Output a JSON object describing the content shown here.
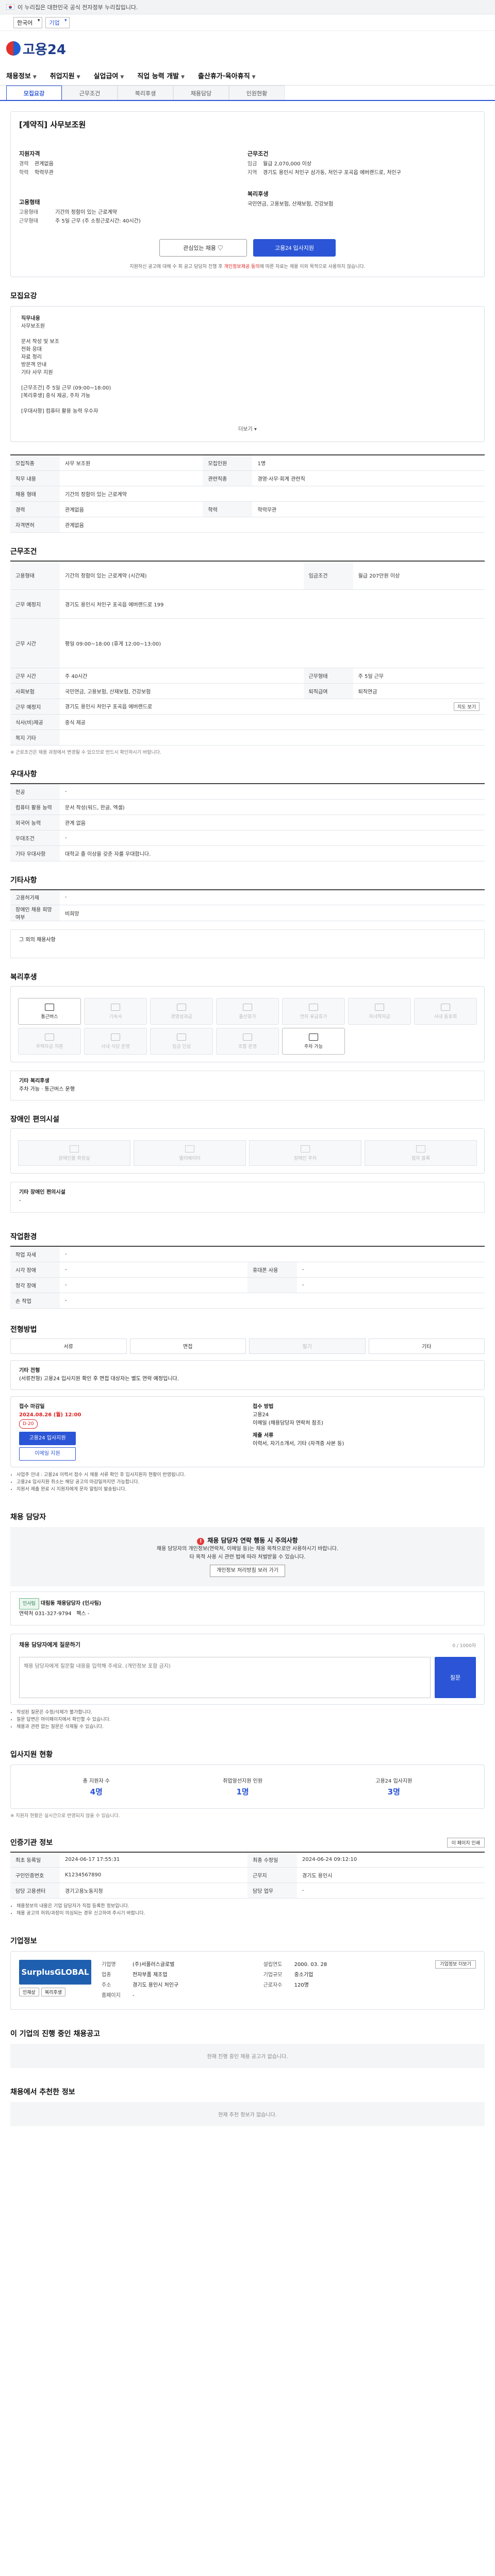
{
  "topbar": {
    "notice": "이 누리집은 대한민국 공식 전자정부 누리집입니다."
  },
  "topbar2": {
    "lang_label": "한국어",
    "lang_select": "기업"
  },
  "brand": {
    "name": "고용24"
  },
  "gnb": [
    "채용정보",
    "취업지원",
    "실업급여",
    "직업 능력 개발",
    "출산휴가·육아휴직"
  ],
  "tabs": [
    "모집요강",
    "근무조건",
    "복리후생",
    "채용담당",
    "인원현황"
  ],
  "job": {
    "title": "[계약직] 사무보조원",
    "left_label": "지원자격",
    "left": [
      [
        "경력",
        "관계없음"
      ],
      [
        "학력",
        "학력무관"
      ]
    ],
    "right_label": "근무조건",
    "right": [
      [
        "임금",
        "월급 2,070,000 이상"
      ],
      [
        "지역",
        "경기도 용인시 처인구 삼가동, 처인구 포곡읍 에버랜드로, 처인구"
      ]
    ],
    "emp_label": "고용형태",
    "emp": [
      [
        "고용형태",
        "기간의 정함이 있는 근로계약"
      ],
      [
        "근무형태",
        "주 5일 근무 (주 소정근로시간: 40시간)"
      ]
    ],
    "benefit_label": "복리후생",
    "benefit": "국민연금, 고용보험, 산재보험, 건강보험"
  },
  "actions": {
    "save": "관심있는 채용 ♡",
    "apply": "고용24 입사지원",
    "note_prefix": "지원하신 공고에 대해 수 회 공고 담당자 진행 후",
    "note_red": "개인정보제공 동의",
    "note_suffix": "에 따른 자료는 채용 이외 목적으로 사용하지 않습니다."
  },
  "recruit": {
    "title": "모집요강",
    "desc_head": "직무내용",
    "desc": [
      "사무보조원",
      "",
      "문서 작성 및 보조",
      "전화 응대",
      "자료 정리",
      "방문객 안내",
      "기타 사무 지원",
      "",
      "[근무조건] 주 5일 근무 (09:00~18:00)",
      "[복리후생] 중식 제공, 주차 가능",
      "",
      "[우대사항] 컴퓨터 활용 능력 우수자"
    ],
    "more": "더보기",
    "rows": [
      [
        "모집직종",
        "사무 보조원",
        "모집인원",
        "1명"
      ],
      [
        "직무 내용",
        "",
        "관련직종",
        "경영·사무·회계 관련직"
      ],
      [
        "채용 형태",
        "기간의 정함이 있는 근로계약",
        "",
        ""
      ],
      [
        "경력",
        "관계없음",
        "학력",
        "학력무관"
      ],
      [
        "자격면허",
        "관계없음",
        "",
        ""
      ]
    ]
  },
  "conditions": {
    "title": "근무조건",
    "rows": [
      [
        "고용형태",
        "기간의 정함이 있는 근로계약 (시간제)",
        "임금조건",
        "월급 207만원 이상"
      ],
      [
        "근무 예정지",
        "경기도 용인시 처인구 포곡읍 에버랜드로 199",
        "",
        ""
      ],
      [
        "근무 시간",
        "평일 09:00~18:00 (휴게 12:00~13:00)",
        "",
        ""
      ],
      [
        "근무 시간",
        "주 40시간",
        "근무형태",
        "주 5일 근무"
      ],
      [
        "사회보험",
        "국민연금, 고용보험, 산재보험, 건강보험",
        "퇴직급여",
        "퇴직연금"
      ],
      [
        "근무 예정지",
        "경기도 용인시 처인구 포곡읍 에버랜드로",
        "",
        ""
      ],
      [
        "식사(비)제공",
        "중식 제공",
        "",
        ""
      ],
      [
        "복지 기타",
        "",
        "",
        ""
      ]
    ],
    "map_btn": "지도 보기",
    "foot": "※ 근로조건은 채용 과정에서 변경될 수 있으므로 반드시 확인하시기 바랍니다."
  },
  "prefer": {
    "title": "우대사항",
    "rows": [
      [
        "전공",
        "-",
        "",
        ""
      ],
      [
        "컴퓨터 활용 능력",
        "문서 작성(워드, 한글, 엑셀)",
        "",
        ""
      ],
      [
        "외국어 능력",
        "관계 없음",
        "",
        ""
      ],
      [
        "우대조건",
        "-",
        "",
        ""
      ],
      [
        "기타 우대사항",
        "대학교 졸 이상을 갖춘 자를 우대합니다.",
        "",
        ""
      ]
    ]
  },
  "preferences": {
    "title": "기타사항",
    "rows": [
      [
        "고용허가제",
        "-"
      ],
      [
        "장애인 채용 희망 여부",
        "비희망"
      ]
    ],
    "etc": "그 외의 채용사항"
  },
  "benefits": {
    "title": "복리후생",
    "items": [
      [
        "통근버스",
        true
      ],
      [
        "기숙사",
        false
      ],
      [
        "경영성과급",
        false
      ],
      [
        "출산휴가",
        false
      ],
      [
        "연차 유급휴가",
        false
      ],
      [
        "자녀학자금",
        false
      ],
      [
        "사내 동호회",
        false
      ],
      [
        "주택자금 지원",
        false
      ],
      [
        "사내 식당 운영",
        false
      ],
      [
        "임금 인상",
        false
      ],
      [
        "조합 운영",
        false
      ],
      [
        "주차 가능",
        true
      ]
    ],
    "sub_head": "기타 복리후생",
    "sub": "주차 가능 · 통근버스 운행"
  },
  "disabled": {
    "title": "장애인 편의시설",
    "items": [
      "장애인용 화장실",
      "엘리베이터",
      "장애인 주차",
      "점자 블록"
    ],
    "sub_head": "기타 장애인 편의시설",
    "sub": "-"
  },
  "workplace": {
    "title": "작업환경",
    "rows": [
      [
        "작업 자세",
        "-",
        "",
        ""
      ],
      [
        "시각 장애",
        "-",
        "휴대폰 사용",
        "-"
      ],
      [
        "청각 장애",
        "-",
        "",
        "-"
      ],
      [
        "손 작업",
        "-",
        "",
        ""
      ]
    ]
  },
  "apply": {
    "title": "전형방법",
    "tabs": [
      [
        "서류",
        false
      ],
      [
        "면접",
        false
      ],
      [
        "필기",
        true
      ],
      [
        "기타",
        false
      ]
    ],
    "etc_head": "기타 전형",
    "etc": "(서류전형) 고용24 입사지원 확인 후 면접 대상자는 별도 연락 예정입니다.",
    "period_head": "접수 마감일",
    "period": "2024.08.26 (월) 12:00",
    "dday": "D-20",
    "apply_btn": "고용24 입사지원",
    "mail_btn": "이메일 지원",
    "method_head": "접수 방법",
    "method": [
      "고용24",
      "이메일 (채용담당자 연락처 참조)"
    ],
    "docs_head": "제출 서류",
    "docs": "이력서, 자기소개서, 기타 (자격증 사본 등)",
    "notes": [
      "사업주 안내 : 고용24 이력서 접수 시 채용 서류 확인 후 입사지원자 현황이 반영됩니다.",
      "고용24 입사지원 취소는 해당 공고의 마감일까지만 가능합니다.",
      "지원서 제출 완료 시 지원자에게 문자 알림이 발송됩니다."
    ]
  },
  "manager": {
    "title": "채용 담당자",
    "warn_title": "채용 담당자 연락 행동 시 주의사항",
    "warn1": "채용 담당자의 개인정보(연락처, 이메일 등)는 채용 목적으로만 사용하시기 바랍니다.",
    "warn2": "타 목적 사용 시 관련 법에 따라 처벌받을 수 있습니다.",
    "warn_btn": "개인정보 처리방침 보러 가기",
    "badge": "인사팀",
    "name": "대림동 채용담당자 (인사팀)",
    "phone_label": "연락처",
    "phone": "031-327-9794",
    "fax_label": "팩스",
    "fax": "-",
    "qa_title": "채용 담당자에게 질문하기",
    "qa_placeholder": "채용 담당자에게 질문할 내용을 입력해 주세요. (개인정보 포함 금지)",
    "qa_btn": "질문",
    "qa_count": "0 / 1000자",
    "qa_notes": [
      "작성된 질문은 수정/삭제가 불가합니다.",
      "질문 답변은 마이페이지에서 확인할 수 있습니다.",
      "채용과 관련 없는 질문은 삭제될 수 있습니다."
    ]
  },
  "stats": {
    "title": "입사지원 현황",
    "items": [
      [
        "총 지원자 수",
        "4명"
      ],
      [
        "취업알선지원 인원",
        "1명"
      ],
      [
        "고용24 입사지원",
        "3명"
      ]
    ],
    "note": "※ 지원자 현황은 실시간으로 반영되지 않을 수 있습니다."
  },
  "auth": {
    "title": "인증기관 정보",
    "print": "이 페이지 인쇄",
    "rows": [
      [
        "최초 등록일",
        "2024-06-17 17:55:31",
        "최종 수정일",
        "2024-06-24 09:12:10"
      ],
      [
        "구인인증번호",
        "K1234567890",
        "근무지",
        "경기도 용인시"
      ],
      [
        "담당 고용센터",
        "경기고용노동지청",
        "담당 업무",
        "-"
      ]
    ],
    "notes": [
      "채용정보의 내용은 기업 담당자가 직접 등록한 정보입니다.",
      "채용 공고의 허위/과장이 의심되는 경우 신고하여 주시기 바랍니다."
    ]
  },
  "company": {
    "title": "기업정보",
    "logo": "SurplusGLOBAL",
    "rows": [
      [
        "기업명",
        "(주)서플러스글로벌",
        "설립연도",
        "2000. 03. 28"
      ],
      [
        "업종",
        "전자부품 제조업",
        "기업규모",
        "중소기업"
      ],
      [
        "주소",
        "경기도 용인시 처인구",
        "근로자수",
        "120명"
      ],
      [
        "홈페이지",
        "-",
        "",
        ""
      ]
    ],
    "btn": "기업정보 더보기",
    "chips": [
      "인재상",
      "복리후생"
    ]
  },
  "others": {
    "title": "이 기업의 진행 중인 채용공고",
    "empty": "현재 진행 중인 채용 공고가 없습니다."
  },
  "recommend": {
    "title": "채용에서 추천한 정보",
    "empty": "현재 추천 정보가 없습니다."
  }
}
